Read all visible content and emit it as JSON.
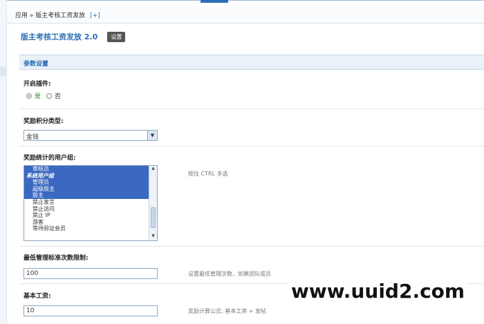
{
  "breadcrumb": {
    "path": "应用 » 版主考核工资发放",
    "plus": "[+]"
  },
  "header": {
    "title": "版主考核工资发放 2.0",
    "settings_button": "设置"
  },
  "section": {
    "title": "参数设置"
  },
  "fields": {
    "enable": {
      "label": "开启插件:",
      "yes": "是",
      "no": "否",
      "selected": "是"
    },
    "reward_type": {
      "label": "奖励积分类型:",
      "value": "金钱"
    },
    "user_groups": {
      "label": "奖励统计的用户组:",
      "hint": "按住 CTRL 多选",
      "options": [
        {
          "text": "审核员",
          "selected": true,
          "group": false
        },
        {
          "text": "系统用户组",
          "selected": true,
          "group": true
        },
        {
          "text": "管理员",
          "selected": true,
          "group": false
        },
        {
          "text": "超级版主",
          "selected": true,
          "group": false
        },
        {
          "text": "版主",
          "selected": true,
          "group": false
        },
        {
          "text": "禁止发言",
          "selected": false,
          "group": false
        },
        {
          "text": "禁止访问",
          "selected": false,
          "group": false
        },
        {
          "text": "禁止 IP",
          "selected": false,
          "group": false
        },
        {
          "text": "游客",
          "selected": false,
          "group": false
        },
        {
          "text": "等待验证会员",
          "selected": false,
          "group": false
        }
      ]
    },
    "min_manage": {
      "label": "最低管理标准次数限制:",
      "value": "100",
      "hint": "设置最低管理次数，如果团队成员"
    },
    "base_salary": {
      "label": "基本工资:",
      "value": "10",
      "hint": "奖励计算公式: 基本工资 + 发帖"
    }
  },
  "watermark": "www.uuid2.com"
}
